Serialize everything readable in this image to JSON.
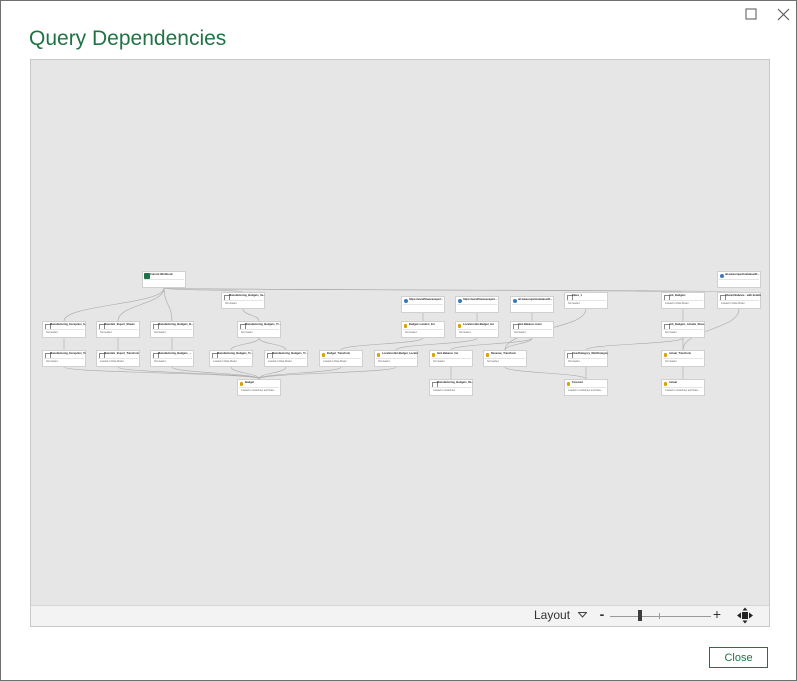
{
  "window": {
    "title": "Query Dependencies",
    "maximize_icon": "maximize-icon",
    "close_icon": "close-icon"
  },
  "graph": {
    "nodes": [
      {
        "id": "source_wb",
        "name": "Current Workbook",
        "status": "",
        "icon": "excel"
      },
      {
        "id": "web1",
        "name": "https://excelfinanceexpert...",
        "status": "",
        "icon": "web"
      },
      {
        "id": "web2",
        "name": "https://excelfinanceexpert...",
        "status": "",
        "icon": "web"
      },
      {
        "id": "web3",
        "name": "all-www.rapartnsdataset/lt...",
        "status": "",
        "icon": "web"
      },
      {
        "id": "dates1",
        "name": "Dates_1",
        "status": "Not loaded",
        "icon": "table"
      },
      {
        "id": "jobbudget",
        "name": "Job_Budgets",
        "status": "Loaded to Data Model",
        "icon": "table"
      },
      {
        "id": "web4",
        "name": "all-www.rapartnsdataset/lt...",
        "status": "",
        "icon": "web"
      },
      {
        "id": "sharedbal",
        "name": "Shared Balance - with details",
        "status": "Loaded to Data Model",
        "icon": "table"
      },
      {
        "id": "mfg_budget_src",
        "name": "Manufacturing_Budgets_Se...",
        "status": "Not loaded",
        "icon": "table"
      },
      {
        "id": "mfg_except",
        "name": "Manufacturing_Exception_S...",
        "status": "Not loaded",
        "icon": "table"
      },
      {
        "id": "matexp",
        "name": "Materials_Export_Sheets",
        "status": "Not loaded",
        "icon": "table"
      },
      {
        "id": "mfg_budget_b",
        "name": "Manufacturing_Budgets_B...",
        "status": "Not loaded",
        "icon": "table"
      },
      {
        "id": "mfg_budget_tr",
        "name": "Manufacturing_Budgets_Tr...",
        "status": "Not loaded",
        "icon": "table"
      },
      {
        "id": "budget_loc",
        "name": "Budget Location_list",
        "status": "Not loaded",
        "icon": "fx"
      },
      {
        "id": "loc_net",
        "name": "Location-Net-Budget_list",
        "status": "Not loaded",
        "icon": "fx"
      },
      {
        "id": "item_balance",
        "name": "Item Balance Lister",
        "status": "Not loaded",
        "icon": "table"
      },
      {
        "id": "job_budget_act",
        "name": "Job_Budgets_Actuals_Recu...",
        "status": "Not loaded",
        "icon": "table"
      },
      {
        "id": "mfg_exc_tr",
        "name": "Manufacturing_Exception_Tr...",
        "status": "Not loaded",
        "icon": "table"
      },
      {
        "id": "matexp_tr",
        "name": "Materials_Export_Transform",
        "status": "Loaded to Data Model",
        "icon": "table"
      },
      {
        "id": "mfg_bud_tr2",
        "name": "Manufacturing_Budgets_...",
        "status": "Not loaded",
        "icon": "table"
      },
      {
        "id": "mfg_bud_tr3",
        "name": "Manufacturing_Budgets_Tr...",
        "status": "Loaded to Data Model",
        "icon": "table"
      },
      {
        "id": "mfg_bud_tr4",
        "name": "Manufacturing_Budgets_Tr...",
        "status": "Loaded to Data Model",
        "icon": "table"
      },
      {
        "id": "budget_tr",
        "name": "Budget_Transform",
        "status": "Loaded to Data Model",
        "icon": "fx"
      },
      {
        "id": "loc_net_tr",
        "name": "Location-Net-Budget_Locatio...",
        "status": "Not loaded",
        "icon": "fx"
      },
      {
        "id": "item_bal_list",
        "name": "Item Balance_list",
        "status": "Not loaded",
        "icon": "fx"
      },
      {
        "id": "revenue_tr",
        "name": "Revenue_Transform",
        "status": "Not loaded",
        "icon": "fx"
      },
      {
        "id": "fixedcat",
        "name": "FixedCategory_MultiCategory",
        "status": "Not loaded",
        "icon": "table"
      },
      {
        "id": "actual_tr",
        "name": "Actual_Transform",
        "status": "Not loaded",
        "icon": "fx"
      },
      {
        "id": "budget",
        "name": "Budget",
        "status": "Loaded to worksheet and Data...",
        "icon": "fx"
      },
      {
        "id": "mfg_budget_re",
        "name": "Manufacturing_Budgets_Re...",
        "status": "Loaded to worksheet",
        "icon": "table"
      },
      {
        "id": "forecast",
        "name": "Forecast",
        "status": "Loaded to worksheet and Data...",
        "icon": "fx"
      },
      {
        "id": "actual",
        "name": "Actual",
        "status": "Loaded to worksheet and Data...",
        "icon": "fx"
      }
    ]
  },
  "toolbar": {
    "layout_label": "Layout",
    "zoom_level": 0.3,
    "zoom_minus": "-",
    "zoom_plus": "+",
    "fit_icon": "fit-to-screen-icon"
  },
  "footer": {
    "close_label": "Close"
  },
  "colors": {
    "accent": "#217346",
    "canvas_bg": "#e6e6e6"
  }
}
